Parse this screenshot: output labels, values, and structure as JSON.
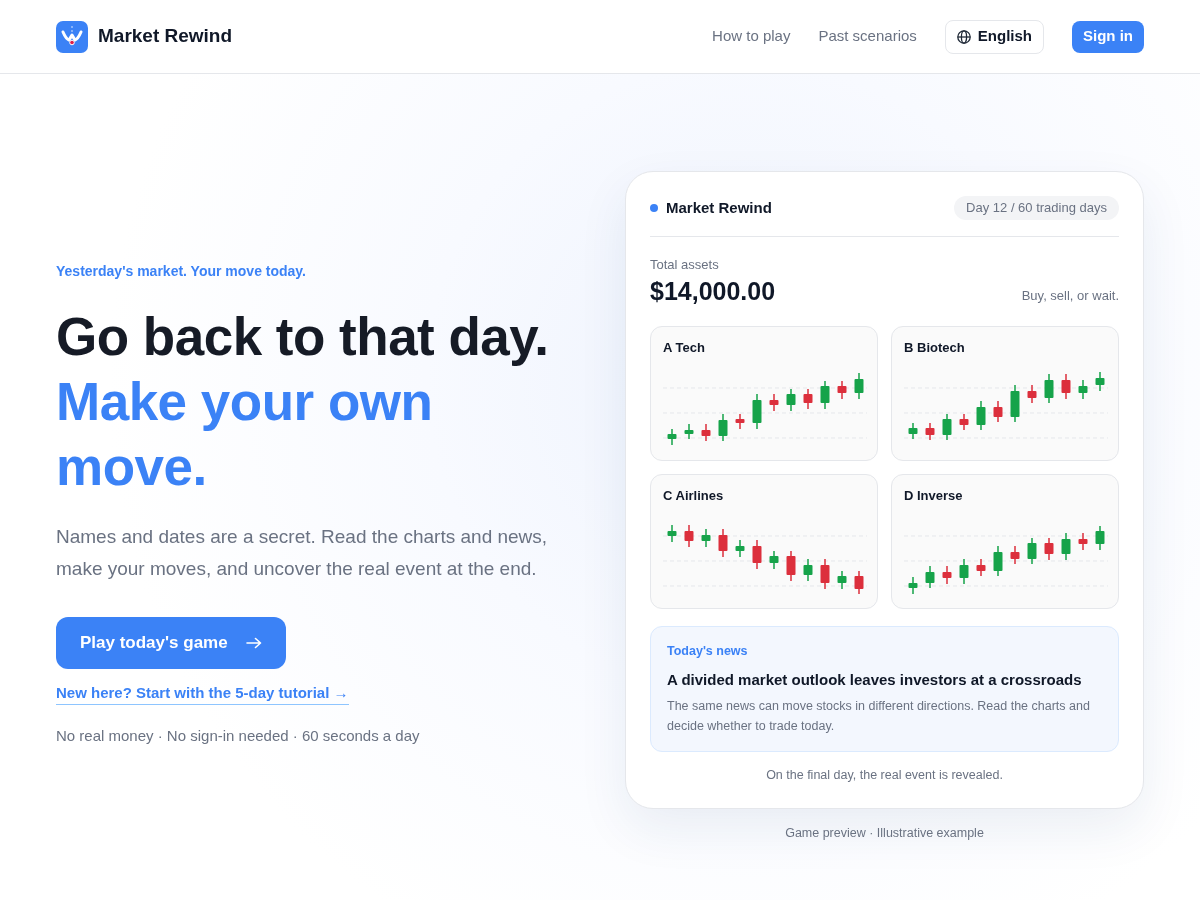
{
  "header": {
    "brand": "Market Rewind",
    "nav": [
      {
        "label": "How to play"
      },
      {
        "label": "Past scenarios"
      }
    ],
    "language_button": "English",
    "sign_in_button": "Sign in"
  },
  "hero": {
    "eyebrow": "Yesterday's market. Your move today.",
    "headline": "Go back to that day.",
    "headline_accent": "Make your own move.",
    "description": "Names and dates are a secret. Read the charts and news, make your moves, and uncover the real event at the end.",
    "primary_button": "Play today's game",
    "tutorial_link": "New here? Start with the 5-day tutorial →",
    "note": "No real money · No sign-in needed · 60 seconds a day"
  },
  "preview": {
    "title": "Market Rewind",
    "day_badge": "Day 12 / 60 trading days",
    "assets_label": "Total assets",
    "assets_value": "$14,000.00",
    "hint": "Buy, sell, or wait.",
    "stocks": [
      {
        "name": "A Tech"
      },
      {
        "name": "B Biotech"
      },
      {
        "name": "C Airlines"
      },
      {
        "name": "D Inverse"
      }
    ],
    "news": {
      "label": "Today's news",
      "headline": "A divided market outlook leaves investors at a crossroads",
      "body": "The same news can move stocks in different directions. Read the charts and decide whether to trade today."
    },
    "footer": "On the final day, the real event is revealed."
  },
  "caption": "Game preview · Illustrative example"
}
